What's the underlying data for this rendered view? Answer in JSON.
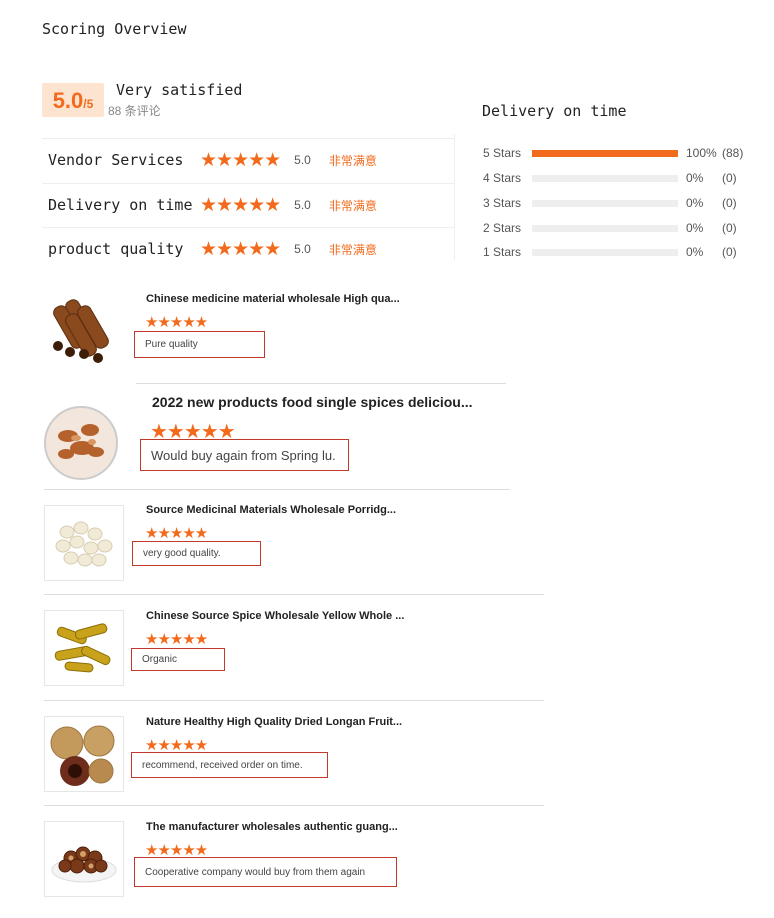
{
  "header": {
    "title": "Scoring Overview"
  },
  "summary": {
    "score": "5.0",
    "score_max": "/5",
    "satisfaction": "Very satisfied",
    "review_count": "88 条评论"
  },
  "categories": [
    {
      "name": "Vendor Services",
      "stars": "★★★★★",
      "value": "5.0",
      "label": "非常满意"
    },
    {
      "name": "Delivery on time",
      "stars": "★★★★★",
      "value": "5.0",
      "label": "非常满意"
    },
    {
      "name": "product quality",
      "stars": "★★★★★",
      "value": "5.0",
      "label": "非常满意"
    }
  ],
  "delivery": {
    "title": "Delivery on time",
    "rows": [
      {
        "label": "5 Stars",
        "fraction": 1.0,
        "pct": "100%",
        "count": "(88)"
      },
      {
        "label": "4 Stars",
        "fraction": 0,
        "pct": "0%",
        "count": "(0)"
      },
      {
        "label": "3 Stars",
        "fraction": 0,
        "pct": "0%",
        "count": "(0)"
      },
      {
        "label": "2 Stars",
        "fraction": 0,
        "pct": "0%",
        "count": "(0)"
      },
      {
        "label": "1 Stars",
        "fraction": 0,
        "pct": "0%",
        "count": "(0)"
      }
    ],
    "accent": "#f26b1d"
  },
  "reviews": [
    {
      "title": "Chinese medicine material wholesale High qua...",
      "stars": "★★★★★",
      "comment": "Pure quality",
      "image_icon": "cinnamon-sticks"
    },
    {
      "title": "2022 new products food single spices deliciou...",
      "stars": "★★★★★",
      "comment": "Would buy again from Spring lu.",
      "image_icon": "dried-spice-bowl"
    },
    {
      "title": "Source Medicinal Materials Wholesale Porridg...",
      "stars": "★★★★★",
      "comment": "very good quality.",
      "image_icon": "white-seeds"
    },
    {
      "title": "Chinese Source Spice Wholesale Yellow Whole ...",
      "stars": "★★★★★",
      "comment": "Organic",
      "image_icon": "turmeric-roots"
    },
    {
      "title": "Nature Healthy High Quality Dried Longan Fruit...",
      "stars": "★★★★★",
      "comment": "recommend, received order on time.",
      "image_icon": "longan-fruit"
    },
    {
      "title": "The manufacturer wholesales authentic guang...",
      "stars": "★★★★★",
      "comment": "Cooperative company would buy from them again",
      "image_icon": "dried-fruit-plate"
    }
  ]
}
